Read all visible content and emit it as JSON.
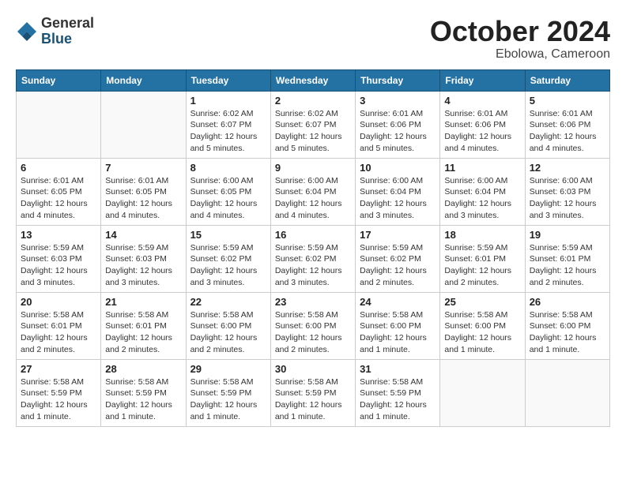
{
  "header": {
    "logo_general": "General",
    "logo_blue": "Blue",
    "month": "October 2024",
    "location": "Ebolowa, Cameroon"
  },
  "days_of_week": [
    "Sunday",
    "Monday",
    "Tuesday",
    "Wednesday",
    "Thursday",
    "Friday",
    "Saturday"
  ],
  "weeks": [
    [
      {
        "day": "",
        "info": ""
      },
      {
        "day": "",
        "info": ""
      },
      {
        "day": "1",
        "info": "Sunrise: 6:02 AM\nSunset: 6:07 PM\nDaylight: 12 hours\nand 5 minutes."
      },
      {
        "day": "2",
        "info": "Sunrise: 6:02 AM\nSunset: 6:07 PM\nDaylight: 12 hours\nand 5 minutes."
      },
      {
        "day": "3",
        "info": "Sunrise: 6:01 AM\nSunset: 6:06 PM\nDaylight: 12 hours\nand 5 minutes."
      },
      {
        "day": "4",
        "info": "Sunrise: 6:01 AM\nSunset: 6:06 PM\nDaylight: 12 hours\nand 4 minutes."
      },
      {
        "day": "5",
        "info": "Sunrise: 6:01 AM\nSunset: 6:06 PM\nDaylight: 12 hours\nand 4 minutes."
      }
    ],
    [
      {
        "day": "6",
        "info": "Sunrise: 6:01 AM\nSunset: 6:05 PM\nDaylight: 12 hours\nand 4 minutes."
      },
      {
        "day": "7",
        "info": "Sunrise: 6:01 AM\nSunset: 6:05 PM\nDaylight: 12 hours\nand 4 minutes."
      },
      {
        "day": "8",
        "info": "Sunrise: 6:00 AM\nSunset: 6:05 PM\nDaylight: 12 hours\nand 4 minutes."
      },
      {
        "day": "9",
        "info": "Sunrise: 6:00 AM\nSunset: 6:04 PM\nDaylight: 12 hours\nand 4 minutes."
      },
      {
        "day": "10",
        "info": "Sunrise: 6:00 AM\nSunset: 6:04 PM\nDaylight: 12 hours\nand 3 minutes."
      },
      {
        "day": "11",
        "info": "Sunrise: 6:00 AM\nSunset: 6:04 PM\nDaylight: 12 hours\nand 3 minutes."
      },
      {
        "day": "12",
        "info": "Sunrise: 6:00 AM\nSunset: 6:03 PM\nDaylight: 12 hours\nand 3 minutes."
      }
    ],
    [
      {
        "day": "13",
        "info": "Sunrise: 5:59 AM\nSunset: 6:03 PM\nDaylight: 12 hours\nand 3 minutes."
      },
      {
        "day": "14",
        "info": "Sunrise: 5:59 AM\nSunset: 6:03 PM\nDaylight: 12 hours\nand 3 minutes."
      },
      {
        "day": "15",
        "info": "Sunrise: 5:59 AM\nSunset: 6:02 PM\nDaylight: 12 hours\nand 3 minutes."
      },
      {
        "day": "16",
        "info": "Sunrise: 5:59 AM\nSunset: 6:02 PM\nDaylight: 12 hours\nand 3 minutes."
      },
      {
        "day": "17",
        "info": "Sunrise: 5:59 AM\nSunset: 6:02 PM\nDaylight: 12 hours\nand 2 minutes."
      },
      {
        "day": "18",
        "info": "Sunrise: 5:59 AM\nSunset: 6:01 PM\nDaylight: 12 hours\nand 2 minutes."
      },
      {
        "day": "19",
        "info": "Sunrise: 5:59 AM\nSunset: 6:01 PM\nDaylight: 12 hours\nand 2 minutes."
      }
    ],
    [
      {
        "day": "20",
        "info": "Sunrise: 5:58 AM\nSunset: 6:01 PM\nDaylight: 12 hours\nand 2 minutes."
      },
      {
        "day": "21",
        "info": "Sunrise: 5:58 AM\nSunset: 6:01 PM\nDaylight: 12 hours\nand 2 minutes."
      },
      {
        "day": "22",
        "info": "Sunrise: 5:58 AM\nSunset: 6:00 PM\nDaylight: 12 hours\nand 2 minutes."
      },
      {
        "day": "23",
        "info": "Sunrise: 5:58 AM\nSunset: 6:00 PM\nDaylight: 12 hours\nand 2 minutes."
      },
      {
        "day": "24",
        "info": "Sunrise: 5:58 AM\nSunset: 6:00 PM\nDaylight: 12 hours\nand 1 minute."
      },
      {
        "day": "25",
        "info": "Sunrise: 5:58 AM\nSunset: 6:00 PM\nDaylight: 12 hours\nand 1 minute."
      },
      {
        "day": "26",
        "info": "Sunrise: 5:58 AM\nSunset: 6:00 PM\nDaylight: 12 hours\nand 1 minute."
      }
    ],
    [
      {
        "day": "27",
        "info": "Sunrise: 5:58 AM\nSunset: 5:59 PM\nDaylight: 12 hours\nand 1 minute."
      },
      {
        "day": "28",
        "info": "Sunrise: 5:58 AM\nSunset: 5:59 PM\nDaylight: 12 hours\nand 1 minute."
      },
      {
        "day": "29",
        "info": "Sunrise: 5:58 AM\nSunset: 5:59 PM\nDaylight: 12 hours\nand 1 minute."
      },
      {
        "day": "30",
        "info": "Sunrise: 5:58 AM\nSunset: 5:59 PM\nDaylight: 12 hours\nand 1 minute."
      },
      {
        "day": "31",
        "info": "Sunrise: 5:58 AM\nSunset: 5:59 PM\nDaylight: 12 hours\nand 1 minute."
      },
      {
        "day": "",
        "info": ""
      },
      {
        "day": "",
        "info": ""
      }
    ]
  ]
}
